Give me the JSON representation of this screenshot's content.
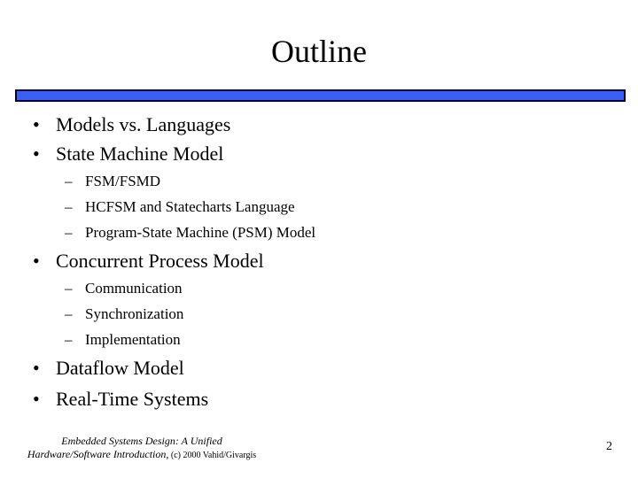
{
  "slide": {
    "title": "Outline",
    "bullets": [
      {
        "marker": "•",
        "text": "Models vs. Languages"
      },
      {
        "marker": "•",
        "text": "State Machine Model",
        "sub": [
          {
            "marker": "–",
            "text": "FSM/FSMD"
          },
          {
            "marker": "–",
            "text": "HCFSM and Statecharts Language"
          },
          {
            "marker": "–",
            "text": "Program-State Machine (PSM) Model"
          }
        ]
      },
      {
        "marker": "•",
        "text": "Concurrent Process Model",
        "sub": [
          {
            "marker": "–",
            "text": "Communication"
          },
          {
            "marker": "–",
            "text": "Synchronization"
          },
          {
            "marker": "–",
            "text": "Implementation"
          }
        ]
      },
      {
        "marker": "•",
        "text": "Dataflow Model"
      },
      {
        "marker": "•",
        "text": "Real-Time Systems"
      }
    ]
  },
  "footer": {
    "line1": "Embedded Systems Design: A Unified",
    "line2_italic": "Hardware/Software Introduction,",
    "line2_small": " (c) 2000 Vahid/Givargis",
    "page_number": "2"
  },
  "colors": {
    "bar_fill": "#3b5ff5",
    "bar_border": "#000033"
  }
}
